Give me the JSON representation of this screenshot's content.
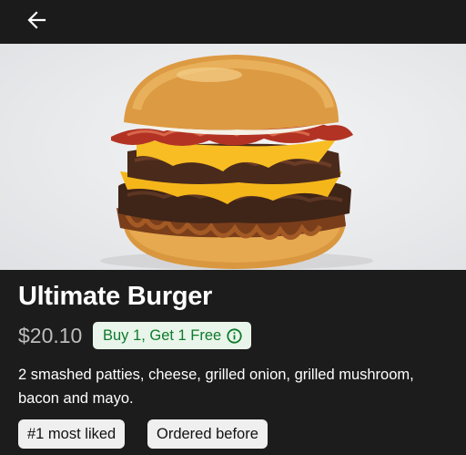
{
  "header": {
    "back_icon": "arrow-left-icon"
  },
  "item": {
    "name": "Ultimate Burger",
    "price": "$20.10",
    "promo_label": "Buy 1, Get 1 Free",
    "promo_icon": "info-icon",
    "description": "2 smashed patties, cheese, grilled onion, grilled mushroom, bacon and mayo.",
    "tags": [
      "#1 most liked",
      "Ordered before"
    ]
  },
  "colors": {
    "background": "#1c1c1c",
    "promo_background": "#e9f5ea",
    "promo_text": "#0e7a2d",
    "tag_background": "#efefef"
  }
}
